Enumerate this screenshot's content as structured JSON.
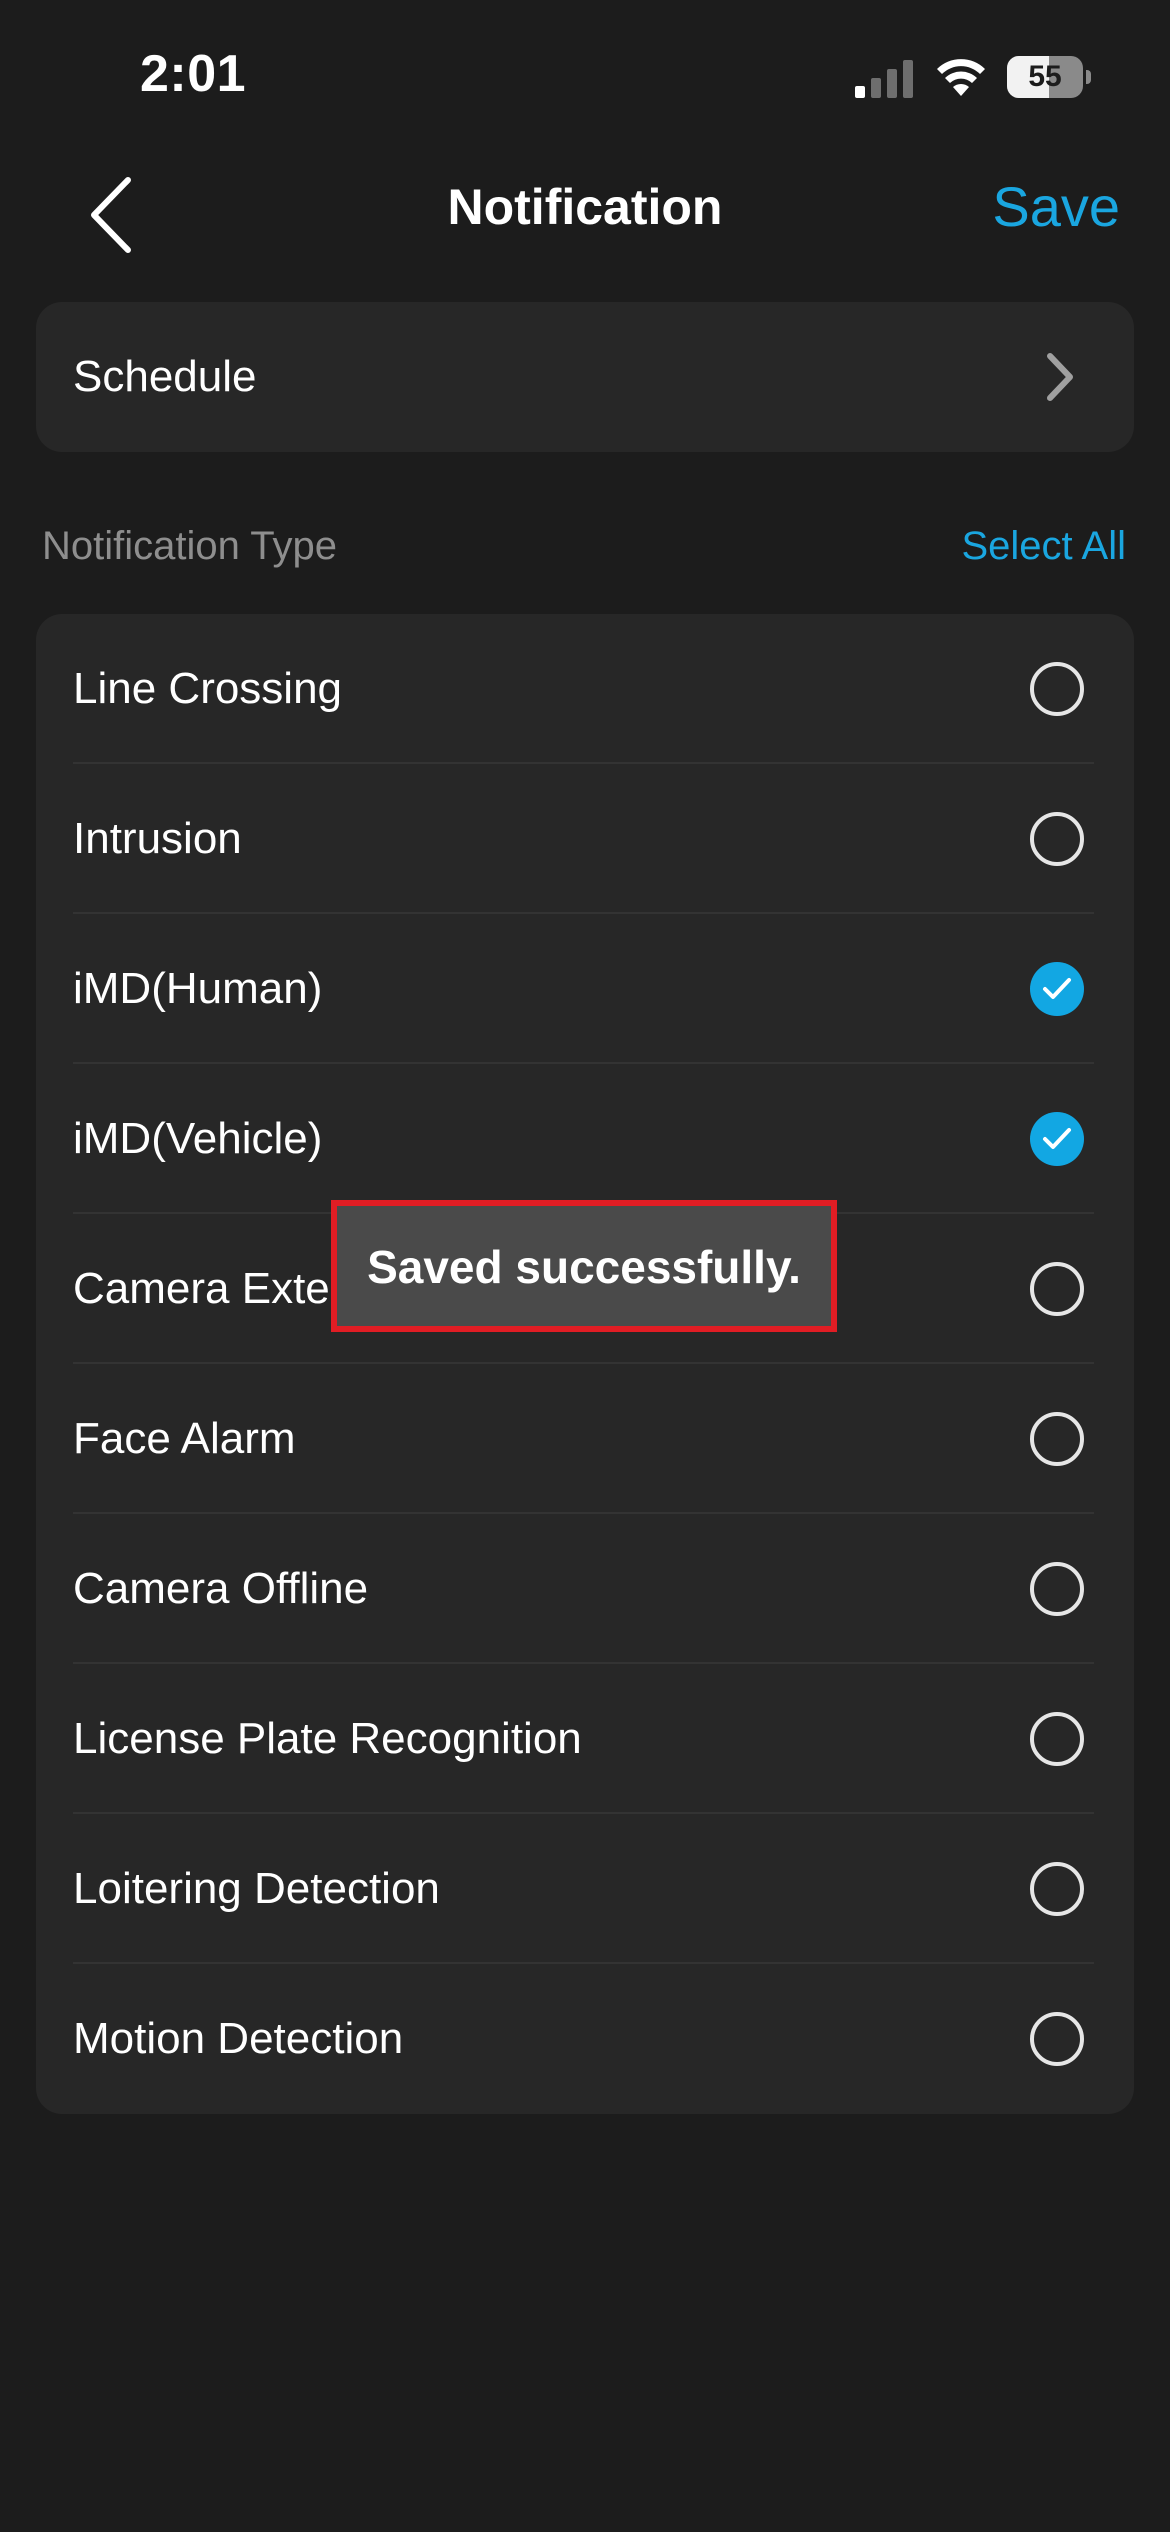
{
  "status_bar": {
    "time": "2:01",
    "battery_percent": "55",
    "battery_level": 0.55,
    "icons": [
      "signal-icon",
      "wifi-icon",
      "battery-icon"
    ]
  },
  "nav": {
    "title": "Notification",
    "save_label": "Save",
    "back_icon": "chevron-left-icon"
  },
  "schedule": {
    "label": "Schedule",
    "icon": "chevron-right-icon"
  },
  "notification_types": {
    "section_title": "Notification Type",
    "select_all_label": "Select All",
    "items": [
      {
        "label": "Line Crossing",
        "checked": false
      },
      {
        "label": "Intrusion",
        "checked": false
      },
      {
        "label": "iMD(Human)",
        "checked": true
      },
      {
        "label": "iMD(Vehicle)",
        "checked": true
      },
      {
        "label": "Camera Exte",
        "checked": false
      },
      {
        "label": "Face Alarm",
        "checked": false
      },
      {
        "label": "Camera Offline",
        "checked": false
      },
      {
        "label": "License Plate Recognition",
        "checked": false
      },
      {
        "label": "Loitering Detection",
        "checked": false
      },
      {
        "label": "Motion Detection",
        "checked": false
      }
    ]
  },
  "toast": {
    "message": "Saved successfully."
  },
  "colors": {
    "background": "#1c1c1c",
    "card": "#272727",
    "accent": "#1aa6e0",
    "toast_border": "#e11d24"
  }
}
